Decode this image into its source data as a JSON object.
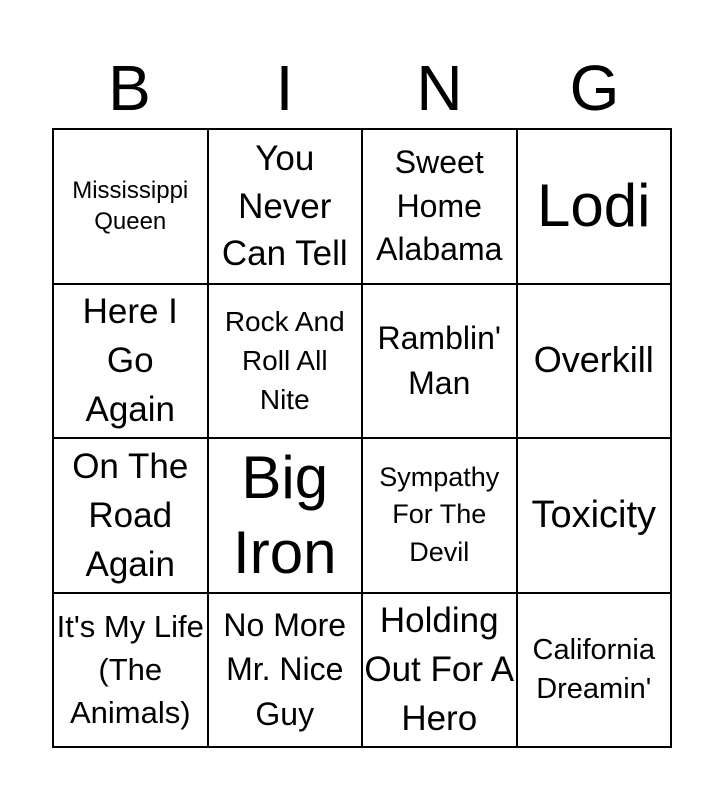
{
  "header": {
    "letters": [
      "B",
      "I",
      "N",
      "G"
    ]
  },
  "cells": [
    "Mississippi Queen",
    "You Never Can Tell",
    "Sweet Home Alabama",
    "Lodi",
    "Here I Go Again",
    "Rock And Roll All Nite",
    "Ramblin' Man",
    "Overkill",
    "On The Road Again",
    "Big Iron",
    "Sympathy For The Devil",
    "Toxicity",
    "It's My Life (The Animals)",
    "No More Mr. Nice Guy",
    "Holding Out For A Hero",
    "California Dreamin'"
  ]
}
